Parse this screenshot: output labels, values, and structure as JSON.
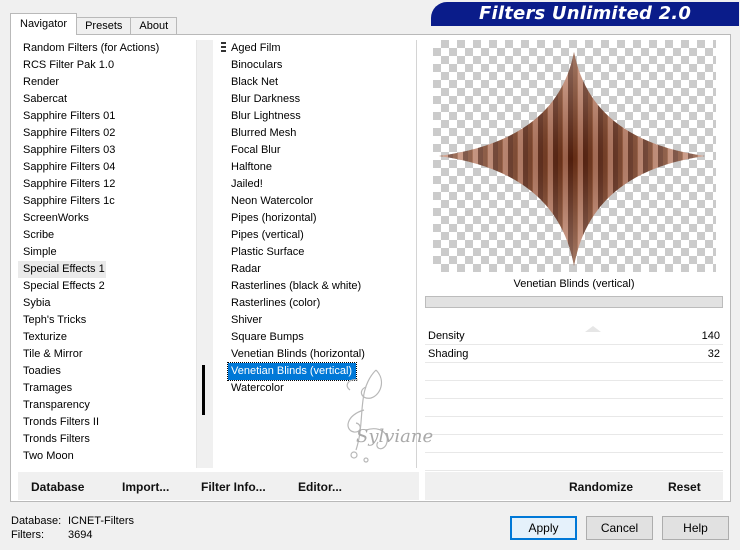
{
  "app": {
    "title": "Filters Unlimited 2.0"
  },
  "tabs": [
    "Navigator",
    "Presets",
    "About"
  ],
  "categories": [
    "Random Filters (for Actions)",
    "RCS Filter Pak 1.0",
    "Render",
    "Sabercat",
    "Sapphire Filters 01",
    "Sapphire Filters 02",
    "Sapphire Filters 03",
    "Sapphire Filters 04",
    "Sapphire Filters 12",
    "Sapphire Filters 1c",
    "ScreenWorks",
    "Scribe",
    "Simple",
    "Special Effects 1",
    "Special Effects 2",
    "Sybia",
    "Teph's Tricks",
    "Texturize",
    "Tile & Mirror",
    "Toadies",
    "Tramages",
    "Transparency",
    "Tronds Filters II",
    "Tronds Filters",
    "Two Moon"
  ],
  "selected_category": "Special Effects 1",
  "filters": [
    "Aged Film",
    "Binoculars",
    "Black Net",
    "Blur Darkness",
    "Blur Lightness",
    "Blurred Mesh",
    "Focal Blur",
    "Halftone",
    "Jailed!",
    "Neon Watercolor",
    "Pipes (horizontal)",
    "Pipes (vertical)",
    "Plastic Surface",
    "Radar",
    "Rasterlines (black & white)",
    "Rasterlines (color)",
    "Shiver",
    "Square Bumps",
    "Venetian Blinds (horizontal)",
    "Venetian Blinds (vertical)",
    "Watercolor"
  ],
  "selected_filter": "Venetian Blinds (vertical)",
  "preview": {
    "filter_name": "Venetian Blinds (vertical)",
    "watermark": "Sylviane"
  },
  "controls": [
    {
      "label": "Density",
      "value": "140"
    },
    {
      "label": "Shading",
      "value": "32"
    }
  ],
  "toolbar_left": {
    "database": "Database",
    "import": "Import...",
    "filter_info": "Filter Info...",
    "editor": "Editor..."
  },
  "toolbar_right": {
    "randomize": "Randomize",
    "reset": "Reset"
  },
  "footer": {
    "database_label": "Database:",
    "database_value": "ICNET-Filters",
    "filters_label": "Filters:",
    "filters_value": "3694",
    "apply": "Apply",
    "cancel": "Cancel",
    "help": "Help"
  },
  "colors": {
    "selection": "#0078d7",
    "banner": "#0a1c8a",
    "shape_dark": "#5b2410",
    "shape_light": "#c9866a"
  }
}
